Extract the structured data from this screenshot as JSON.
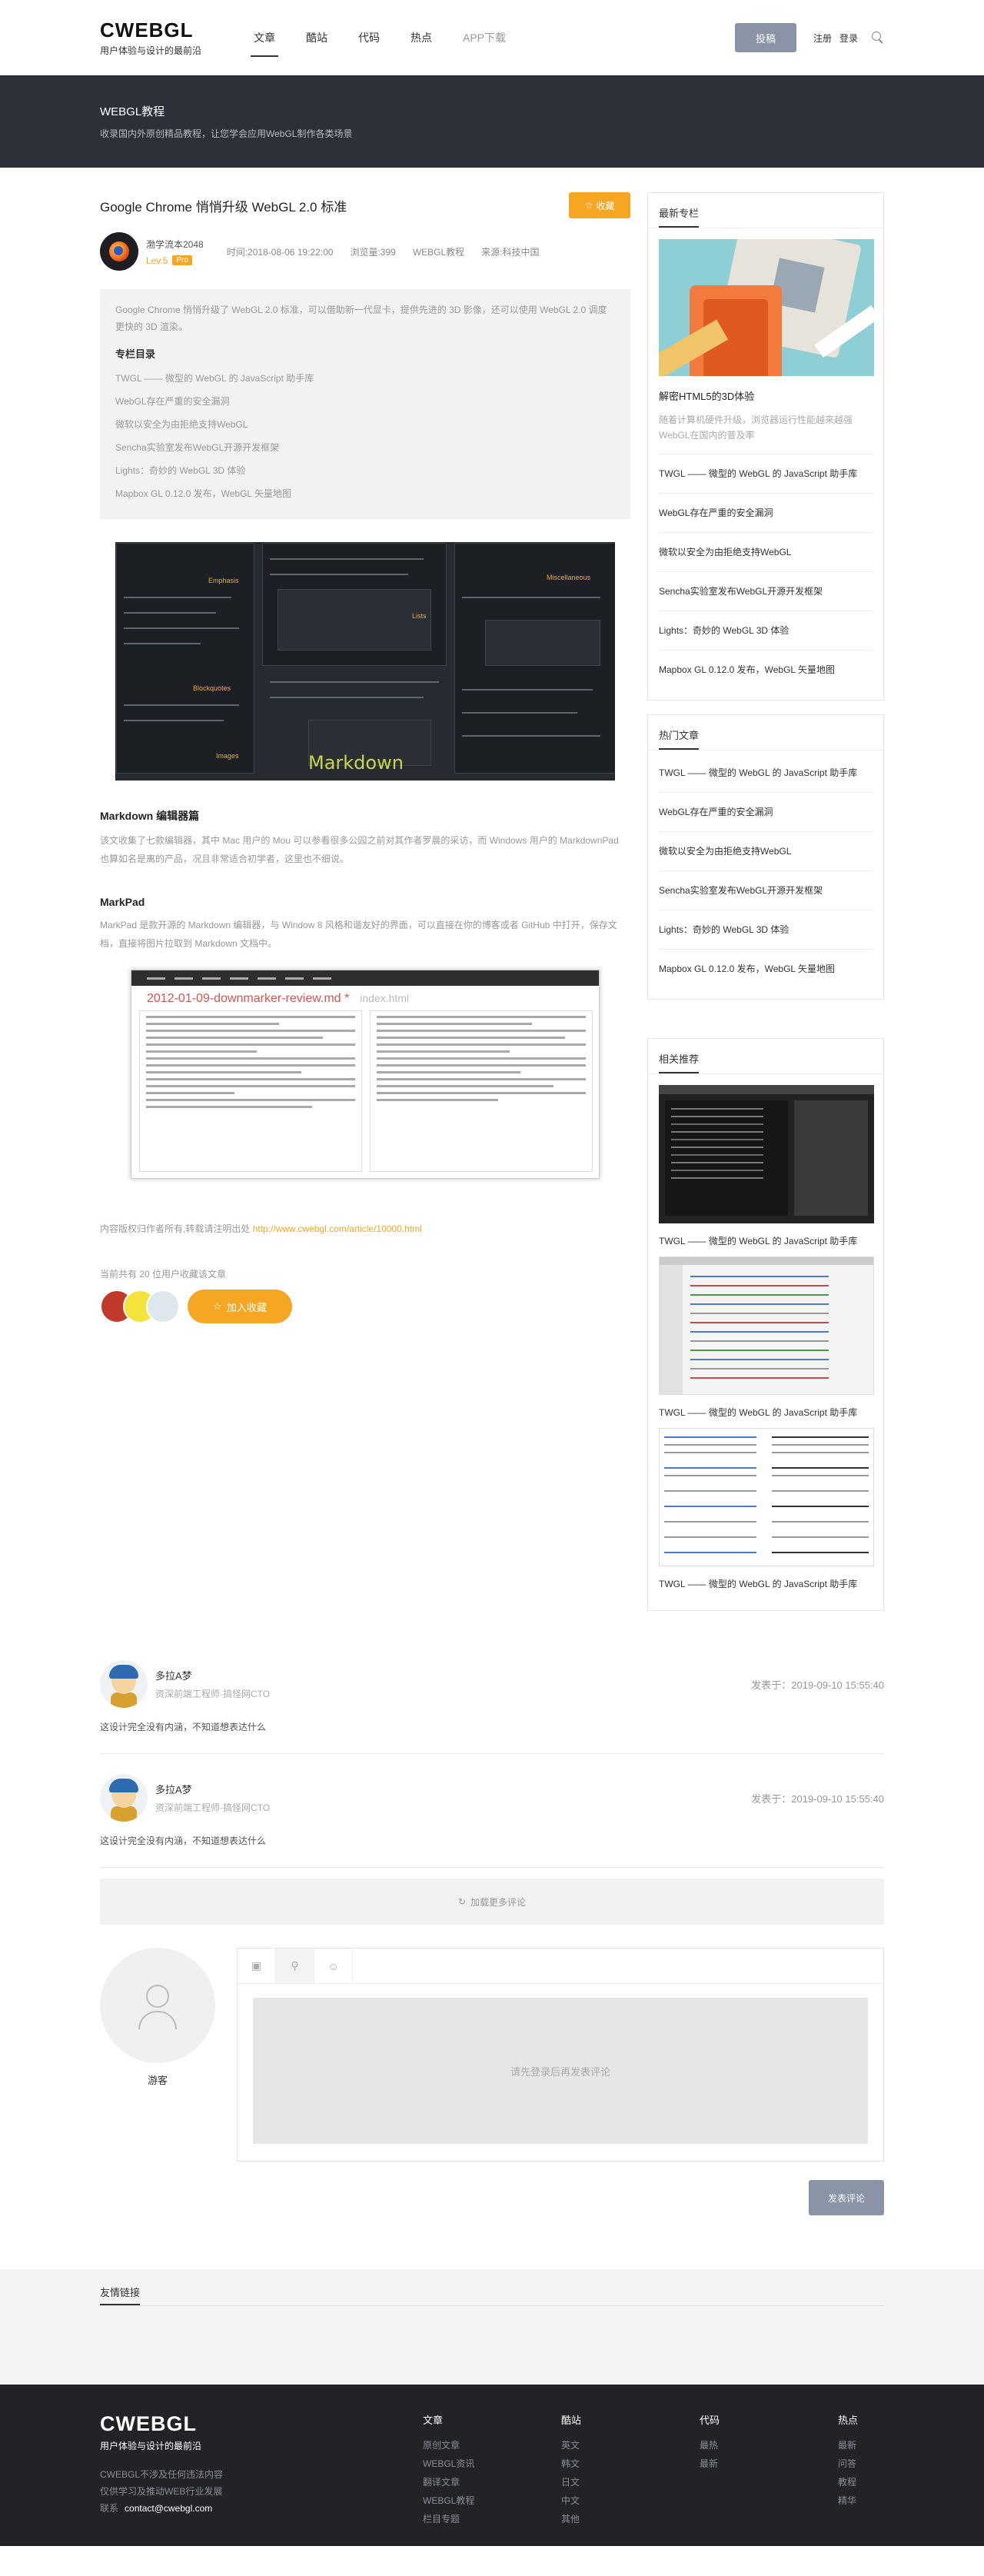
{
  "header": {
    "logo": "CWEBGL",
    "tagline": "用户体验与设计的最前沿",
    "nav": [
      "文章",
      "酷站",
      "代码",
      "热点",
      "APP下载"
    ],
    "submit": "投稿",
    "register": "注册",
    "login": "登录"
  },
  "banner": {
    "title": "WEBGL教程",
    "subtitle": "收录国内外原创精品教程，让您学会应用WebGL制作各类场景"
  },
  "article": {
    "title": "Google Chrome 悄悄升级 WebGL 2.0 标准",
    "fav_btn": "收藏",
    "author": "渤学流本2048",
    "level": "Lev.5",
    "pro": "Pro",
    "time": "时间:2018-08-06 19:22:00",
    "views": "浏览量:399",
    "category": "WEBGL教程",
    "source": "来源:科技中国",
    "summary": "Google Chrome 悄悄升级了 WebGL 2.0 标准，可以借助新一代显卡，提供先进的 3D 影像，还可以使用 WebGL 2.0 调度更快的 3D 渲染。",
    "toc_title": "专栏目录",
    "toc": [
      "TWGL —— 微型的 WebGL 的 JavaScript 助手库",
      "WebGL存在严重的安全漏洞",
      "微软以安全为由拒绝支持WebGL",
      "Sencha实验室发布WebGL开源开发框架",
      "Lights：奇妙的 WebGL 3D 体验",
      "Mapbox GL 0.12.0 发布，WebGL 矢量地图"
    ],
    "img1_caption": "Markdown",
    "sec1_title": "Markdown 编辑器篇",
    "sec1_text": "该文收集了七款编辑器，其中 Mac 用户的 Mou 可以参看很多公园之前对其作者罗晨的采访，而 Windows 用户的 MarkdownPad 也算如名是离的产品，况且非常适合初学者，这里也不细说。",
    "sec2_title": "MarkPad",
    "sec2_text": "MarkPad 是款开源的 Markdown 编辑器，与 Window 8 风格和谐友好的界面，可以直接在你的博客或者 GitHub 中打开，保存文档，直接将图片拉取到 Markdown 文档中。",
    "img2_title": "2012-01-09-downmarker-review.md *",
    "img2_tab": "index.html",
    "copyright_prefix": "内容版权归作者所有,转载请注明出处",
    "copyright_link": "http://www.cwebgl.com/article/10000.html",
    "fav_count": "当前共有 20 位用户收藏该文章",
    "join_fav": "加入收藏"
  },
  "sidebar": {
    "latest_title": "最新专栏",
    "feature_title": "解密HTML5的3D体验",
    "feature_desc": "随着计算机硬件升级，浏览器运行性能越来越强WebGL在国内的普及率",
    "latest_list": [
      "TWGL —— 微型的 WebGL 的 JavaScript 助手库",
      "WebGL存在严重的安全漏洞",
      "微软以安全为由拒绝支持WebGL",
      "Sencha实验室发布WebGL开源开发框架",
      "Lights：奇妙的 WebGL 3D 体验",
      "Mapbox GL 0.12.0 发布，WebGL 矢量地图"
    ],
    "hot_title": "热门文章",
    "hot_list": [
      "TWGL —— 微型的 WebGL 的 JavaScript 助手库",
      "WebGL存在严重的安全漏洞",
      "微软以安全为由拒绝支持WebGL",
      "Sencha实验室发布WebGL开源开发框架",
      "Lights：奇妙的 WebGL 3D 体验",
      "Mapbox GL 0.12.0 发布，WebGL 矢量地图"
    ],
    "rec_title": "相关推荐",
    "rec_list": [
      "TWGL —— 微型的 WebGL 的 JavaScript 助手库",
      "TWGL —— 微型的 WebGL 的 JavaScript 助手库",
      "TWGL —— 微型的 WebGL 的 JavaScript 助手库"
    ]
  },
  "comments": [
    {
      "name": "多拉A梦",
      "role": "资深前端工程师·搞怪网CTO",
      "time": "发表于：2019-09-10 15:55:40",
      "text": "这设计完全没有内涵，不知道想表达什么"
    },
    {
      "name": "多拉A梦",
      "role": "资深前端工程师·搞怪网CTO",
      "time": "发表于：2019-09-10 15:55:40",
      "text": "这设计完全没有内涵，不知道想表达什么"
    }
  ],
  "load_more": "加载更多评论",
  "editor": {
    "guest": "游客",
    "placeholder": "请先登录后再发表评论",
    "post": "发表评论"
  },
  "links": {
    "title": "友情链接"
  },
  "footer": {
    "logo": "CWEBGL",
    "tagline": "用户体验与设计的最前沿",
    "desc1": "CWEBGL不涉及任何违法内容",
    "desc2": "仅供学习及推动WEB行业发展",
    "contact_label": "联系",
    "contact": "contact@cwebgl.com",
    "cols": [
      {
        "title": "文章",
        "items": [
          "原创文章",
          "WEBGL资讯",
          "翻译文章",
          "WEBGL教程",
          "栏目专题"
        ]
      },
      {
        "title": "酷站",
        "items": [
          "英文",
          "韩文",
          "日文",
          "中文",
          "其他"
        ]
      },
      {
        "title": "代码",
        "items": [
          "最热",
          "最新"
        ]
      },
      {
        "title": "热点",
        "items": [
          "最新",
          "问答",
          "教程",
          "精华"
        ]
      }
    ]
  },
  "colors": {
    "accent": "#f5a623",
    "dark": "#2d3039",
    "button_gray": "#8a94a6"
  }
}
